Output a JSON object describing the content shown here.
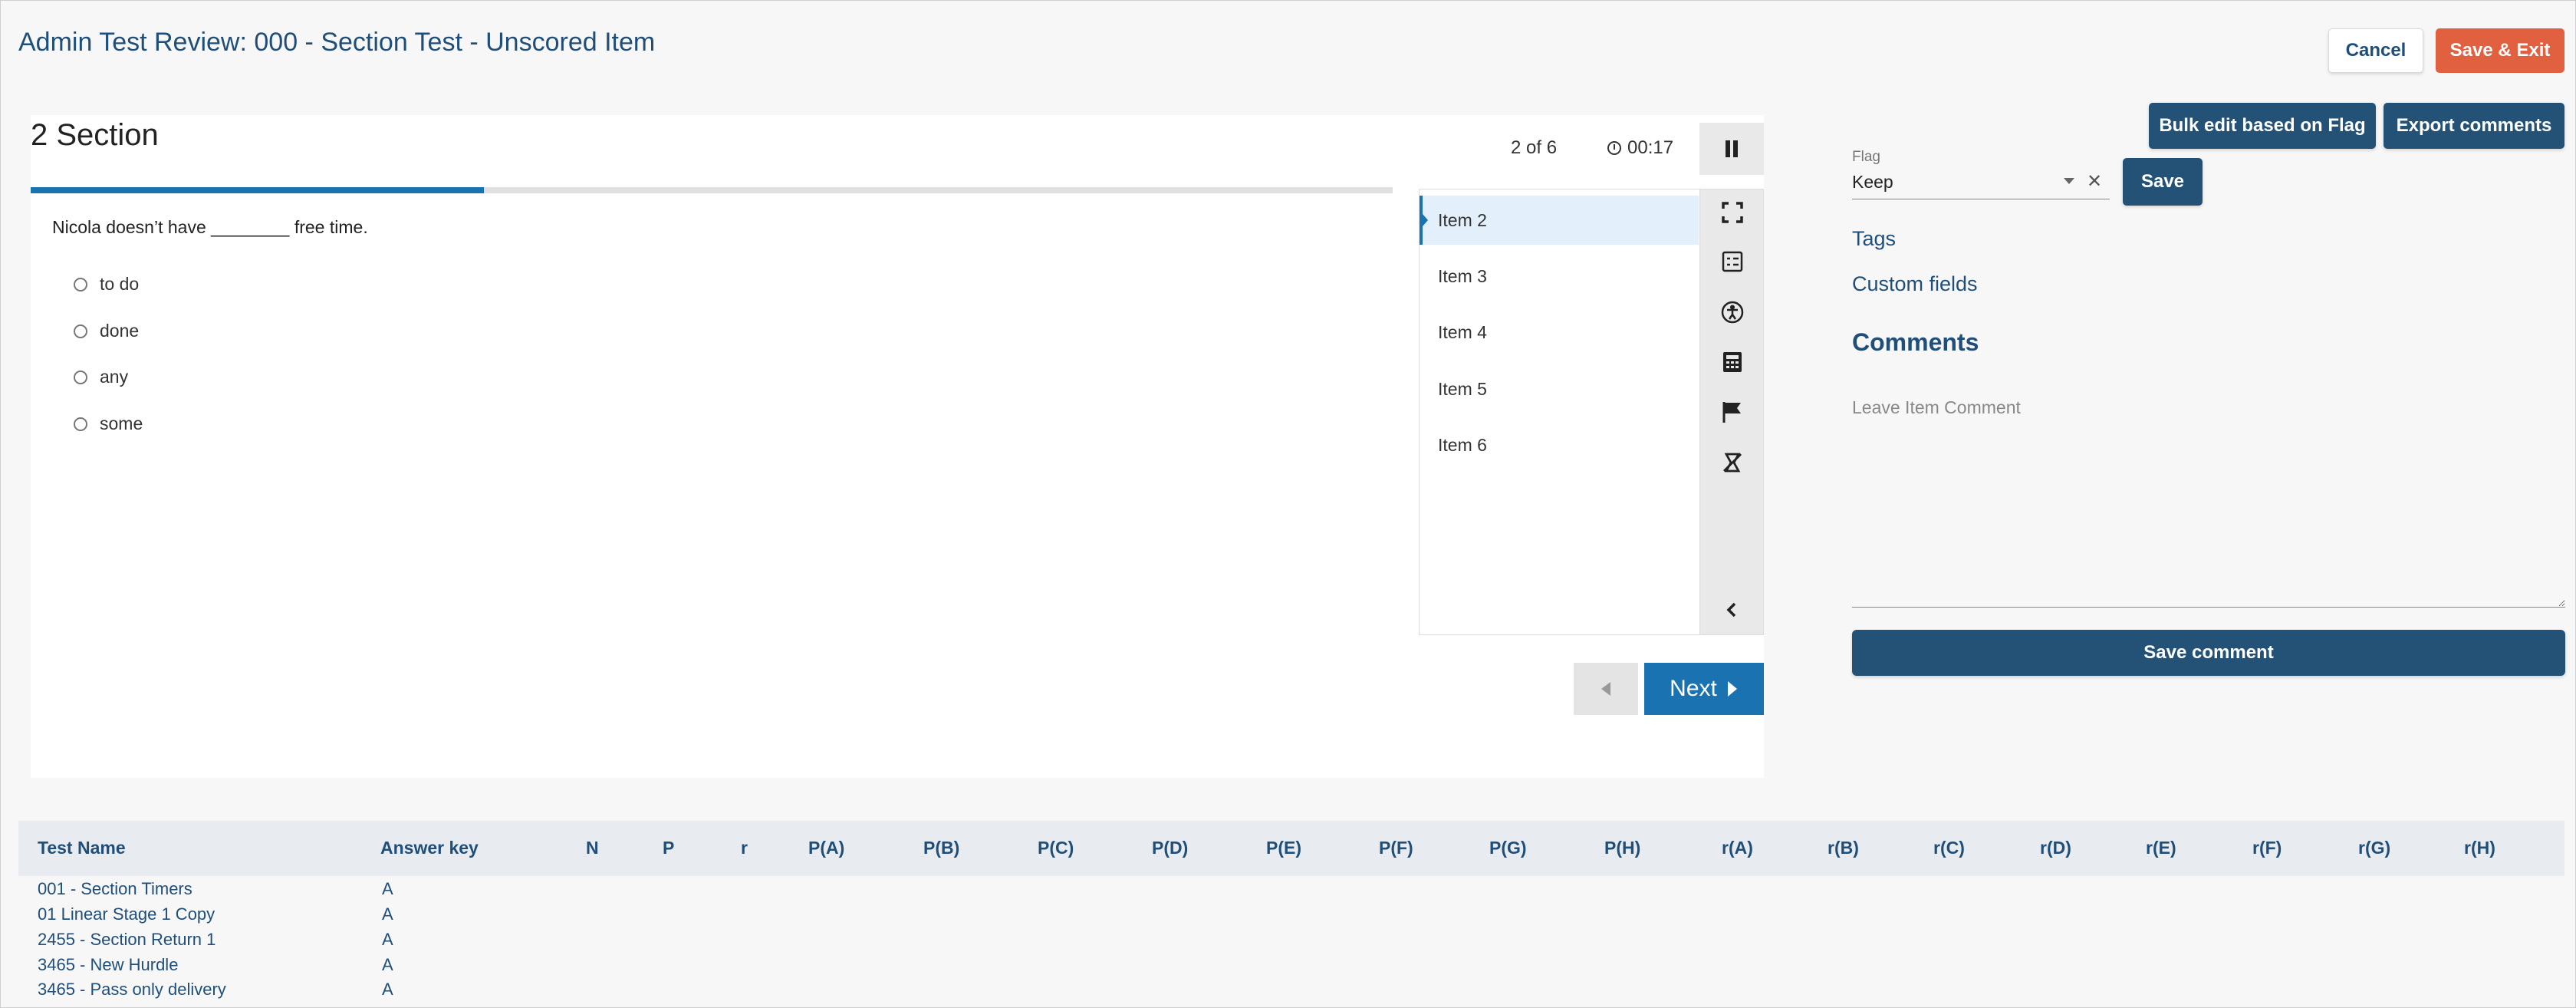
{
  "header": {
    "title": "Admin Test Review: 000 - Section Test - Unscored Item",
    "cancel_label": "Cancel",
    "save_exit_label": "Save & Exit"
  },
  "colors": {
    "primary": "#1a73b0",
    "dark_button": "#245277",
    "save_exit": "#e0603f",
    "heading": "#1f4e79"
  },
  "test": {
    "section_title": "2 Section",
    "counter": "2 of 6",
    "timer": "00:17",
    "progress_fraction": 0.333,
    "question": "Nicola doesn’t have ________ free time.",
    "options": [
      "to do",
      "done",
      "any",
      "some"
    ],
    "items": [
      "Item 2",
      "Item 3",
      "Item 4",
      "Item 5",
      "Item 6"
    ],
    "active_item": "Item 2",
    "tools": [
      "fullscreen-icon",
      "checklist-icon",
      "accessibility-icon",
      "calculator-icon",
      "flag-icon",
      "timer-off-icon",
      "chevron-left-icon"
    ],
    "next_label": "Next"
  },
  "sidebar": {
    "bulk_edit_label": "Bulk edit based on Flag",
    "export_label": "Export comments",
    "flag_label": "Flag",
    "flag_value": "Keep",
    "save_label": "Save",
    "tags_label": "Tags",
    "custom_fields_label": "Custom fields",
    "comments_title": "Comments",
    "comment_placeholder": "Leave Item Comment",
    "save_comment_label": "Save comment"
  },
  "table": {
    "headers": [
      "Test Name",
      "Answer key",
      "N",
      "P",
      "r",
      "P(A)",
      "P(B)",
      "P(C)",
      "P(D)",
      "P(E)",
      "P(F)",
      "P(G)",
      "P(H)",
      "r(A)",
      "r(B)",
      "r(C)",
      "r(D)",
      "r(E)",
      "r(F)",
      "r(G)",
      "r(H)"
    ],
    "rows": [
      {
        "name": "001 - Section Timers",
        "key": "A"
      },
      {
        "name": "01 Linear Stage 1 Copy",
        "key": "A"
      },
      {
        "name": "2455 - Section Return 1",
        "key": "A"
      },
      {
        "name": "3465 - New Hurdle",
        "key": "A"
      },
      {
        "name": "3465 - Pass only delivery",
        "key": "A"
      }
    ]
  }
}
